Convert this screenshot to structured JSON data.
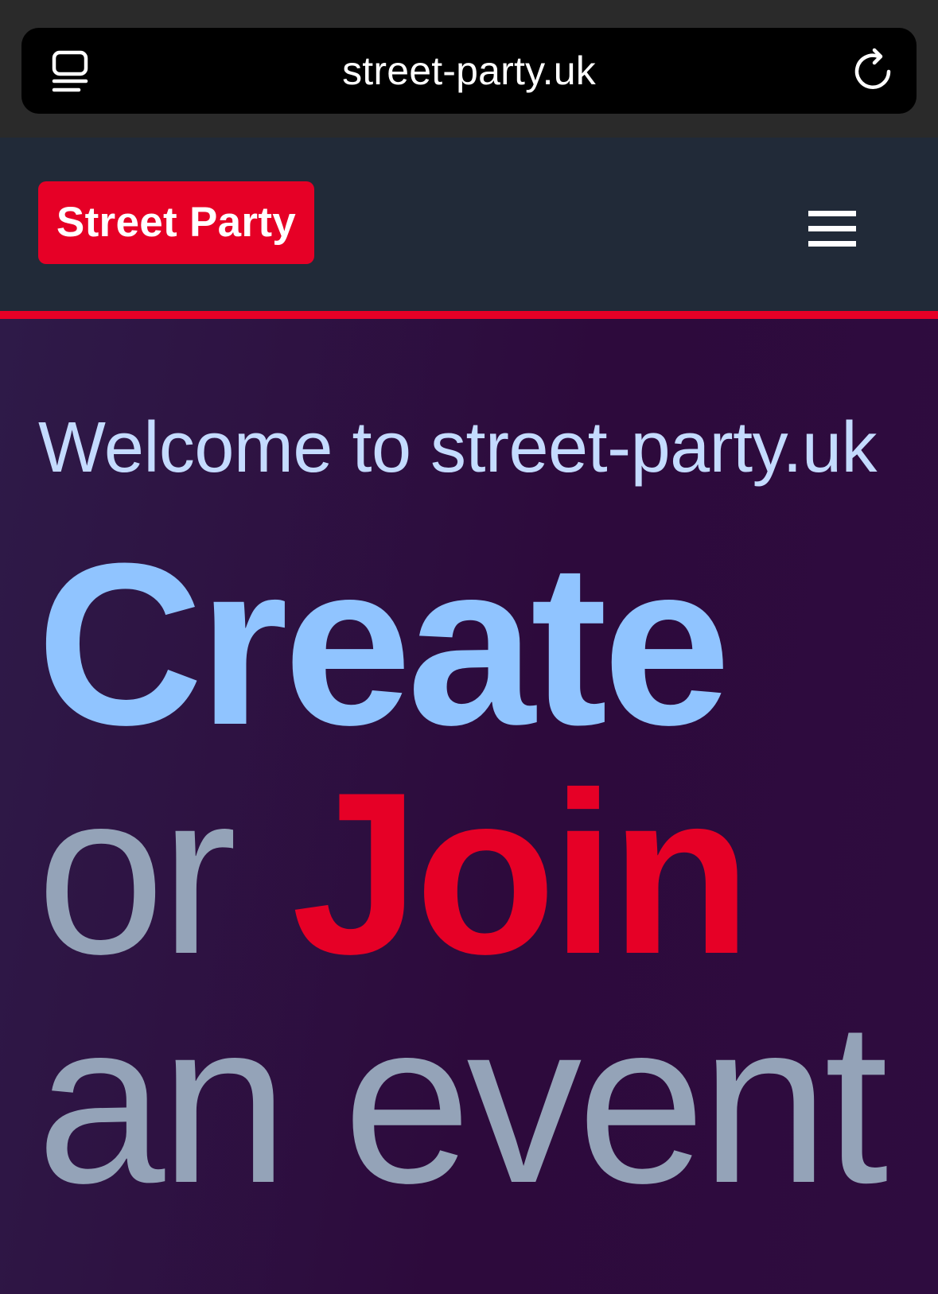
{
  "browser": {
    "url": "street-party.uk",
    "tabs_icon": "tab-overview-icon",
    "reload_icon": "reload-icon"
  },
  "header": {
    "logo_text": "Street Party",
    "menu_icon": "hamburger-menu-icon"
  },
  "hero": {
    "welcome": "Welcome to street-party.uk",
    "headline": {
      "word_create": "Create",
      "word_or": "or",
      "word_join": "Join",
      "word_event": "an event"
    }
  },
  "colors": {
    "brand_red": "#e60026",
    "header_bg": "#212a38",
    "hero_bg": "#2d0a3c",
    "accent_blue": "#90c4ff",
    "muted_slate": "#94a3b8",
    "welcome_text": "#c4dbff"
  }
}
